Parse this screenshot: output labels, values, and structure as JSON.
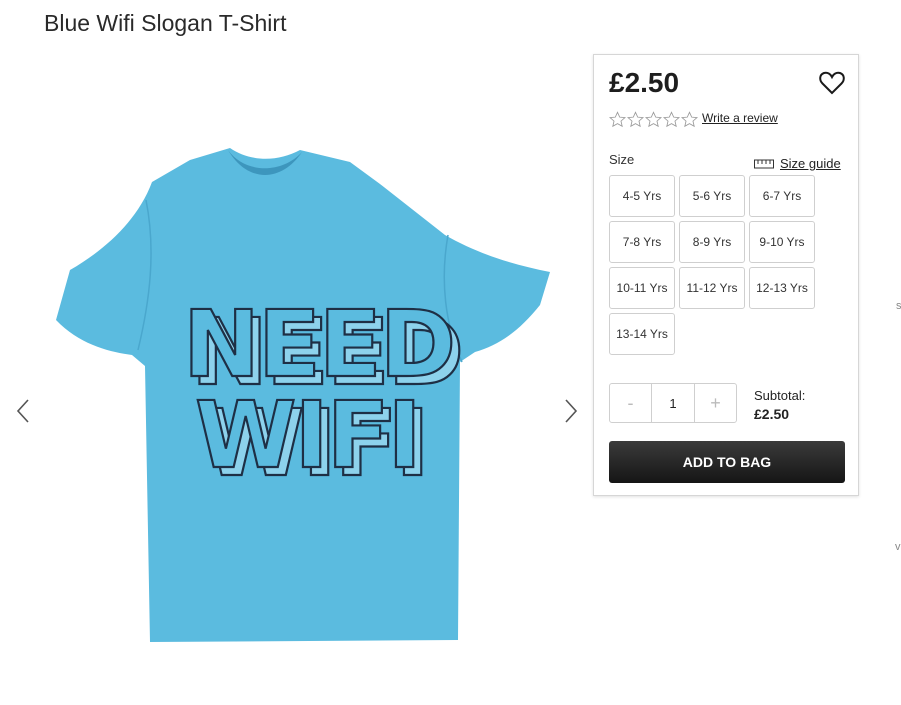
{
  "product": {
    "title": "Blue Wifi Slogan T-Shirt",
    "print_line1": "NEED",
    "print_line2": "WIFI",
    "shirt_color": "#5bbbdf"
  },
  "gallery": {
    "prev_icon": "chevron-left-icon",
    "next_icon": "chevron-right-icon"
  },
  "purchase": {
    "price": "£2.50",
    "wishlist_icon": "heart-icon",
    "rating_stars": 5,
    "rating_value": 0,
    "review_link": "Write a review",
    "size_label": "Size",
    "size_guide_label": "Size guide",
    "sizes": [
      "4-5 Yrs",
      "5-6 Yrs",
      "6-7 Yrs",
      "7-8 Yrs",
      "8-9 Yrs",
      "9-10 Yrs",
      "10-11 Yrs",
      "11-12 Yrs",
      "12-13 Yrs",
      "13-14 Yrs"
    ],
    "qty_minus": "-",
    "qty_value": "1",
    "qty_plus": "+",
    "subtotal_label": "Subtotal:",
    "subtotal_value": "£2.50",
    "add_to_bag": "ADD TO BAG"
  },
  "edge_marks": [
    "s",
    "v"
  ]
}
